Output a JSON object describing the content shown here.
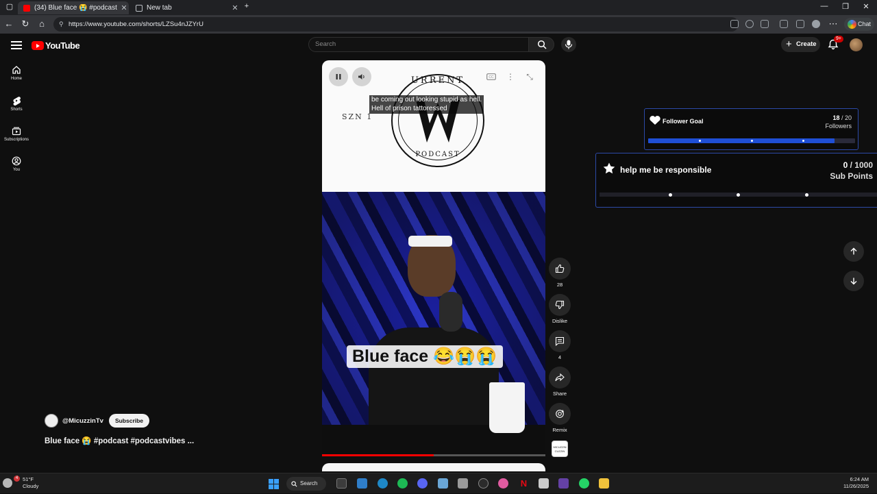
{
  "browser": {
    "tabs": [
      {
        "label": "(34) Blue face 😭 #podcast",
        "active": true
      },
      {
        "label": "New tab",
        "active": false
      }
    ],
    "url": "https://www.youtube.com/shorts/LZSu4nJZYrU",
    "chat_label": "Chat"
  },
  "masthead": {
    "logo_text": "YouTube",
    "search_placeholder": "Search",
    "create_label": "Create",
    "notification_count": "9+"
  },
  "guide": [
    {
      "label": "Home",
      "icon": "home-icon"
    },
    {
      "label": "Shorts",
      "icon": "shorts-icon"
    },
    {
      "label": "Subscriptions",
      "icon": "subscriptions-icon"
    },
    {
      "label": "You",
      "icon": "you-icon"
    }
  ],
  "video": {
    "caption_lines": [
      "be coming out looking stupid as hell.",
      "Hell of prison tattoressed"
    ],
    "overlay_text": "Blue face 😂😭😭",
    "progress": 0.5,
    "logo_top": "URRENT",
    "logo_bottom": "PODCAST",
    "logo_small": "SZN 1"
  },
  "actions": {
    "like_count": "28",
    "dislike_label": "Dislike",
    "comment_count": "4",
    "share_label": "Share",
    "remix_label": "Remix"
  },
  "channel": {
    "handle": "@MicuzzinTv",
    "subscribe_label": "Subscribe",
    "title": "Blue face 😭 #podcast #podcastvibes ..."
  },
  "follower_goal": {
    "title": "Follower Goal",
    "current": "18",
    "target": " / 20",
    "unit": "Followers",
    "fraction": 0.9
  },
  "sub_goal": {
    "title": "help me be responsible",
    "current": "0",
    "target": " / 1000",
    "unit": "Sub Points",
    "fraction": 0
  },
  "taskbar": {
    "weather_temp": "51°F",
    "weather_desc": "Cloudy",
    "weather_badge": "4",
    "search_label": "Search",
    "time": "6:24 AM",
    "date": "11/26/2025"
  },
  "colors": {
    "youtube_red": "#ff0000",
    "goal_blue": "#1f4fd6",
    "goal_border": "#2c4aa8"
  }
}
